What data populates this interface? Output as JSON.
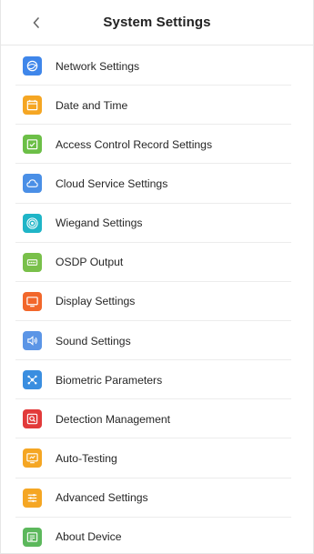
{
  "header": {
    "title": "System Settings",
    "back_icon": "chevron-left-icon"
  },
  "items": [
    {
      "label": "Network Settings",
      "icon": "network-icon",
      "color": "#3f86ea"
    },
    {
      "label": "Date and Time",
      "icon": "calendar-icon",
      "color": "#f5a623"
    },
    {
      "label": "Access Control Record Settings",
      "icon": "record-icon",
      "color": "#6cbf47"
    },
    {
      "label": "Cloud Service Settings",
      "icon": "cloud-icon",
      "color": "#4a8fe6"
    },
    {
      "label": "Wiegand Settings",
      "icon": "wiegand-icon",
      "color": "#1fb5c7"
    },
    {
      "label": "OSDP Output",
      "icon": "osdp-icon",
      "color": "#79c04a"
    },
    {
      "label": "Display Settings",
      "icon": "display-icon",
      "color": "#f2672b"
    },
    {
      "label": "Sound Settings",
      "icon": "speaker-icon",
      "color": "#5b95e6"
    },
    {
      "label": "Biometric Parameters",
      "icon": "biometric-icon",
      "color": "#3a8ee0"
    },
    {
      "label": "Detection Management",
      "icon": "detection-icon",
      "color": "#e23a3a"
    },
    {
      "label": "Auto-Testing",
      "icon": "auto-test-icon",
      "color": "#f5a623"
    },
    {
      "label": "Advanced Settings",
      "icon": "advanced-icon",
      "color": "#f5a623"
    },
    {
      "label": "About Device",
      "icon": "about-icon",
      "color": "#5cb85c"
    }
  ]
}
